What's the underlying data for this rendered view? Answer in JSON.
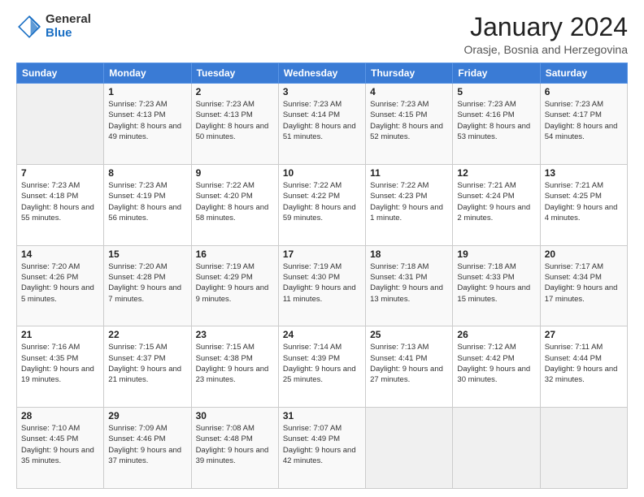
{
  "logo": {
    "general": "General",
    "blue": "Blue"
  },
  "header": {
    "title": "January 2024",
    "location": "Orasje, Bosnia and Herzegovina"
  },
  "weekdays": [
    "Sunday",
    "Monday",
    "Tuesday",
    "Wednesday",
    "Thursday",
    "Friday",
    "Saturday"
  ],
  "weeks": [
    [
      {
        "day": "",
        "sunrise": "",
        "sunset": "",
        "daylight": ""
      },
      {
        "day": "1",
        "sunrise": "Sunrise: 7:23 AM",
        "sunset": "Sunset: 4:13 PM",
        "daylight": "Daylight: 8 hours and 49 minutes."
      },
      {
        "day": "2",
        "sunrise": "Sunrise: 7:23 AM",
        "sunset": "Sunset: 4:13 PM",
        "daylight": "Daylight: 8 hours and 50 minutes."
      },
      {
        "day": "3",
        "sunrise": "Sunrise: 7:23 AM",
        "sunset": "Sunset: 4:14 PM",
        "daylight": "Daylight: 8 hours and 51 minutes."
      },
      {
        "day": "4",
        "sunrise": "Sunrise: 7:23 AM",
        "sunset": "Sunset: 4:15 PM",
        "daylight": "Daylight: 8 hours and 52 minutes."
      },
      {
        "day": "5",
        "sunrise": "Sunrise: 7:23 AM",
        "sunset": "Sunset: 4:16 PM",
        "daylight": "Daylight: 8 hours and 53 minutes."
      },
      {
        "day": "6",
        "sunrise": "Sunrise: 7:23 AM",
        "sunset": "Sunset: 4:17 PM",
        "daylight": "Daylight: 8 hours and 54 minutes."
      }
    ],
    [
      {
        "day": "7",
        "sunrise": "Sunrise: 7:23 AM",
        "sunset": "Sunset: 4:18 PM",
        "daylight": "Daylight: 8 hours and 55 minutes."
      },
      {
        "day": "8",
        "sunrise": "Sunrise: 7:23 AM",
        "sunset": "Sunset: 4:19 PM",
        "daylight": "Daylight: 8 hours and 56 minutes."
      },
      {
        "day": "9",
        "sunrise": "Sunrise: 7:22 AM",
        "sunset": "Sunset: 4:20 PM",
        "daylight": "Daylight: 8 hours and 58 minutes."
      },
      {
        "day": "10",
        "sunrise": "Sunrise: 7:22 AM",
        "sunset": "Sunset: 4:22 PM",
        "daylight": "Daylight: 8 hours and 59 minutes."
      },
      {
        "day": "11",
        "sunrise": "Sunrise: 7:22 AM",
        "sunset": "Sunset: 4:23 PM",
        "daylight": "Daylight: 9 hours and 1 minute."
      },
      {
        "day": "12",
        "sunrise": "Sunrise: 7:21 AM",
        "sunset": "Sunset: 4:24 PM",
        "daylight": "Daylight: 9 hours and 2 minutes."
      },
      {
        "day": "13",
        "sunrise": "Sunrise: 7:21 AM",
        "sunset": "Sunset: 4:25 PM",
        "daylight": "Daylight: 9 hours and 4 minutes."
      }
    ],
    [
      {
        "day": "14",
        "sunrise": "Sunrise: 7:20 AM",
        "sunset": "Sunset: 4:26 PM",
        "daylight": "Daylight: 9 hours and 5 minutes."
      },
      {
        "day": "15",
        "sunrise": "Sunrise: 7:20 AM",
        "sunset": "Sunset: 4:28 PM",
        "daylight": "Daylight: 9 hours and 7 minutes."
      },
      {
        "day": "16",
        "sunrise": "Sunrise: 7:19 AM",
        "sunset": "Sunset: 4:29 PM",
        "daylight": "Daylight: 9 hours and 9 minutes."
      },
      {
        "day": "17",
        "sunrise": "Sunrise: 7:19 AM",
        "sunset": "Sunset: 4:30 PM",
        "daylight": "Daylight: 9 hours and 11 minutes."
      },
      {
        "day": "18",
        "sunrise": "Sunrise: 7:18 AM",
        "sunset": "Sunset: 4:31 PM",
        "daylight": "Daylight: 9 hours and 13 minutes."
      },
      {
        "day": "19",
        "sunrise": "Sunrise: 7:18 AM",
        "sunset": "Sunset: 4:33 PM",
        "daylight": "Daylight: 9 hours and 15 minutes."
      },
      {
        "day": "20",
        "sunrise": "Sunrise: 7:17 AM",
        "sunset": "Sunset: 4:34 PM",
        "daylight": "Daylight: 9 hours and 17 minutes."
      }
    ],
    [
      {
        "day": "21",
        "sunrise": "Sunrise: 7:16 AM",
        "sunset": "Sunset: 4:35 PM",
        "daylight": "Daylight: 9 hours and 19 minutes."
      },
      {
        "day": "22",
        "sunrise": "Sunrise: 7:15 AM",
        "sunset": "Sunset: 4:37 PM",
        "daylight": "Daylight: 9 hours and 21 minutes."
      },
      {
        "day": "23",
        "sunrise": "Sunrise: 7:15 AM",
        "sunset": "Sunset: 4:38 PM",
        "daylight": "Daylight: 9 hours and 23 minutes."
      },
      {
        "day": "24",
        "sunrise": "Sunrise: 7:14 AM",
        "sunset": "Sunset: 4:39 PM",
        "daylight": "Daylight: 9 hours and 25 minutes."
      },
      {
        "day": "25",
        "sunrise": "Sunrise: 7:13 AM",
        "sunset": "Sunset: 4:41 PM",
        "daylight": "Daylight: 9 hours and 27 minutes."
      },
      {
        "day": "26",
        "sunrise": "Sunrise: 7:12 AM",
        "sunset": "Sunset: 4:42 PM",
        "daylight": "Daylight: 9 hours and 30 minutes."
      },
      {
        "day": "27",
        "sunrise": "Sunrise: 7:11 AM",
        "sunset": "Sunset: 4:44 PM",
        "daylight": "Daylight: 9 hours and 32 minutes."
      }
    ],
    [
      {
        "day": "28",
        "sunrise": "Sunrise: 7:10 AM",
        "sunset": "Sunset: 4:45 PM",
        "daylight": "Daylight: 9 hours and 35 minutes."
      },
      {
        "day": "29",
        "sunrise": "Sunrise: 7:09 AM",
        "sunset": "Sunset: 4:46 PM",
        "daylight": "Daylight: 9 hours and 37 minutes."
      },
      {
        "day": "30",
        "sunrise": "Sunrise: 7:08 AM",
        "sunset": "Sunset: 4:48 PM",
        "daylight": "Daylight: 9 hours and 39 minutes."
      },
      {
        "day": "31",
        "sunrise": "Sunrise: 7:07 AM",
        "sunset": "Sunset: 4:49 PM",
        "daylight": "Daylight: 9 hours and 42 minutes."
      },
      {
        "day": "",
        "sunrise": "",
        "sunset": "",
        "daylight": ""
      },
      {
        "day": "",
        "sunrise": "",
        "sunset": "",
        "daylight": ""
      },
      {
        "day": "",
        "sunrise": "",
        "sunset": "",
        "daylight": ""
      }
    ]
  ]
}
